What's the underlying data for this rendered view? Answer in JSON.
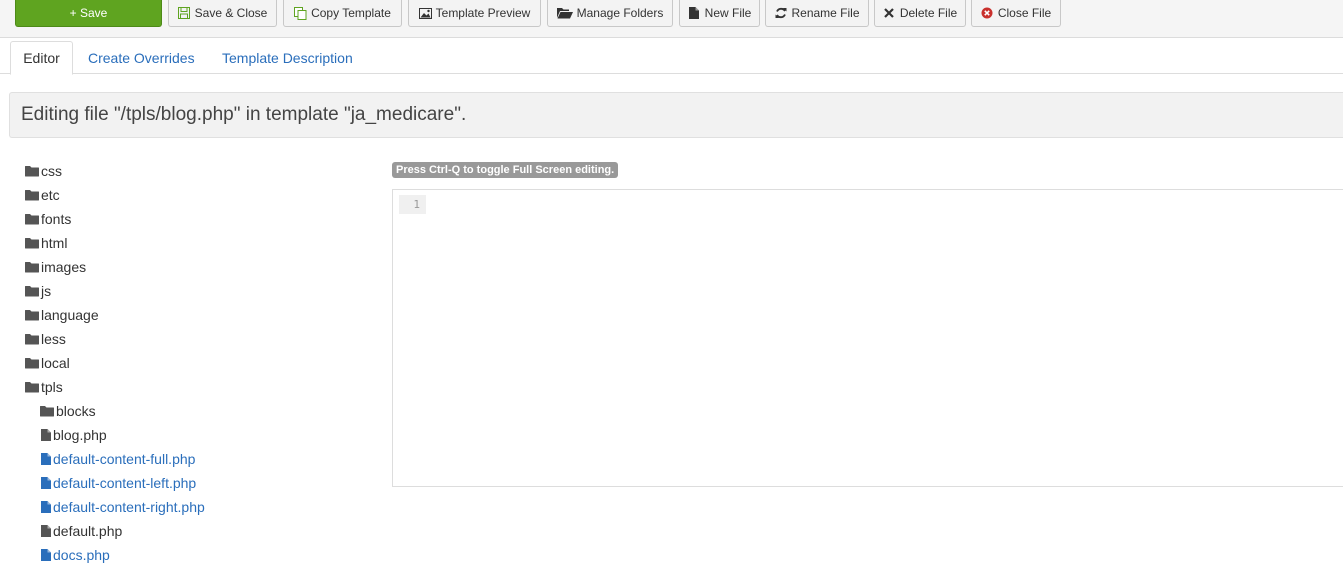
{
  "toolbar": {
    "save": "+ Save",
    "save_close": "Save & Close",
    "copy_template": "Copy Template",
    "template_preview": "Template Preview",
    "manage_folders": "Manage Folders",
    "new_file": "New File",
    "rename_file": "Rename File",
    "delete_file": "Delete File",
    "close_file": "Close File"
  },
  "tabs": {
    "editor": "Editor",
    "create_overrides": "Create Overrides",
    "template_description": "Template Description"
  },
  "heading": "Editing file \"/tpls/blog.php\" in template \"ja_medicare\".",
  "tree": {
    "folders": [
      "css",
      "etc",
      "fonts",
      "html",
      "images",
      "js",
      "language",
      "less",
      "local",
      "tpls"
    ],
    "tpls_children": [
      "blocks",
      "blog.php",
      "default-content-full.php",
      "default-content-left.php",
      "default-content-right.php",
      "default.php",
      "docs.php"
    ]
  },
  "editor": {
    "hint": "Press Ctrl-Q to toggle Full Screen editing.",
    "line_number": "1"
  },
  "colors": {
    "save_green": "#5fa420",
    "link_blue": "#2a6ebb"
  }
}
